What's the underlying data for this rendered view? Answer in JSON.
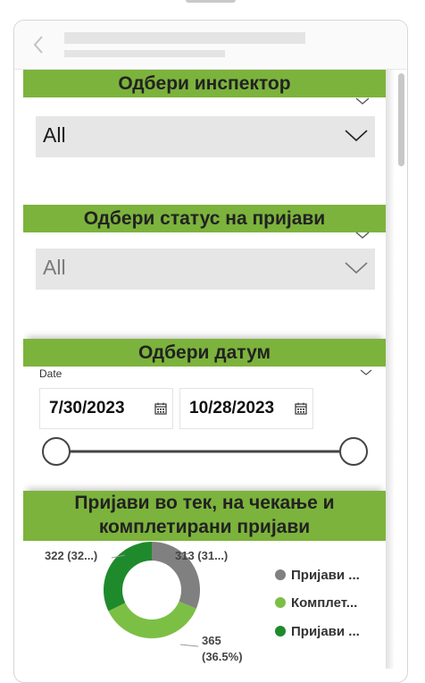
{
  "filters": {
    "inspector": {
      "title": "Одбери инспектор",
      "value": "All"
    },
    "status": {
      "title": "Одбери статус на пријави",
      "value": "All"
    },
    "date": {
      "title": "Одбери датум",
      "label": "Date",
      "start": "7/30/2023",
      "end": "10/28/2023"
    }
  },
  "chart_data": {
    "type": "pie",
    "title": "Пријави во тек, на чекање и комплетирани пријави",
    "slices": [
      {
        "name": "Пријави ...",
        "value": 313,
        "label": "313 (31...)",
        "color": "#808080"
      },
      {
        "name": "Комплет...",
        "value": 365,
        "label": "365 (36.5%)",
        "color": "#7cbf45"
      },
      {
        "name": "Пријави ...",
        "value": 322,
        "label": "322 (32...)",
        "color": "#1f8a2c"
      }
    ],
    "legend_position": "right"
  }
}
